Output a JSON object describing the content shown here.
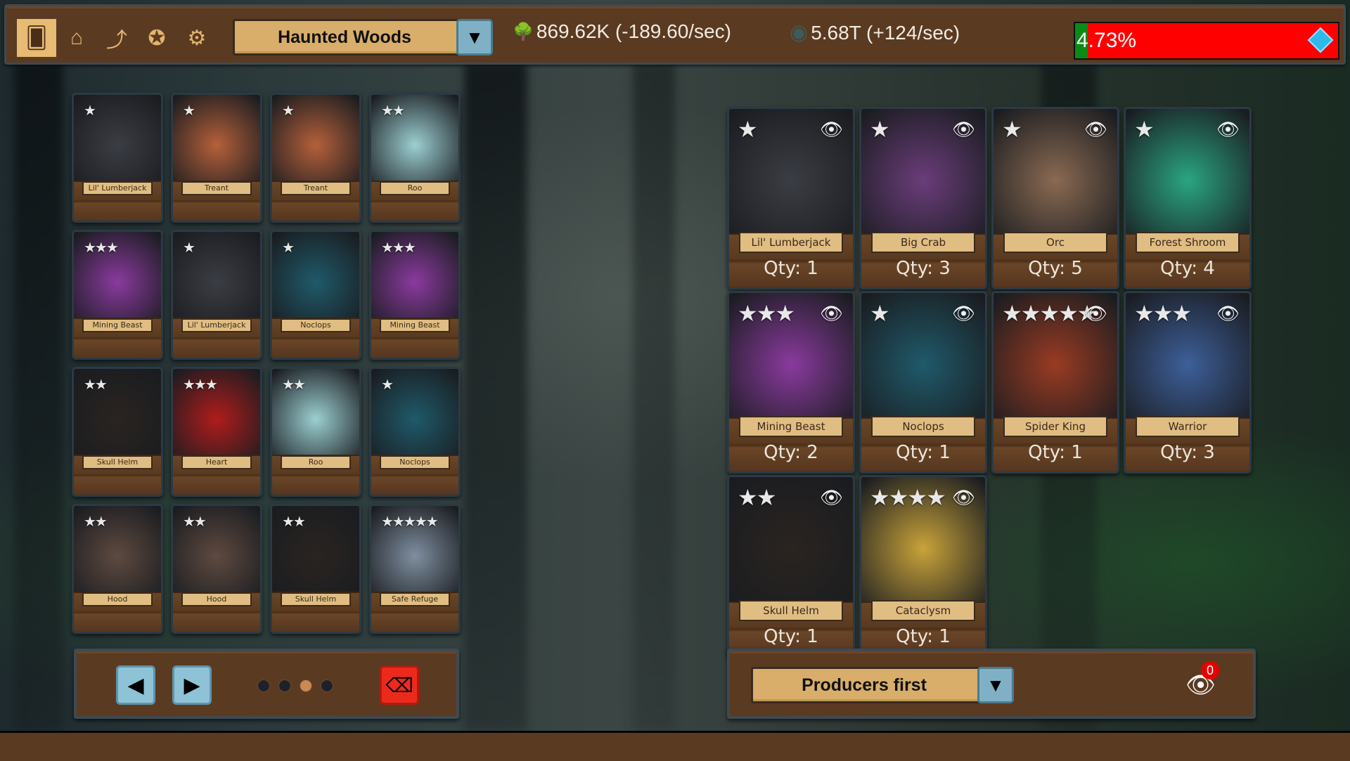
{
  "topbar": {
    "nav": [
      {
        "name": "cards-icon",
        "glyph": "🂠",
        "active": true
      },
      {
        "name": "shop-icon",
        "glyph": "⌂",
        "active": false
      },
      {
        "name": "upgrade-arrow-icon",
        "glyph": "⤴",
        "active": false
      },
      {
        "name": "achievement-medal-icon",
        "glyph": "✪",
        "active": false
      },
      {
        "name": "settings-gears-icon",
        "glyph": "⚙",
        "active": false
      }
    ],
    "region": "Haunted Woods",
    "dropdown_arrow": "▼",
    "resources": [
      {
        "icon": "tree-icon",
        "glyph": "🌳",
        "value": "869.62K (-189.60/sec)"
      },
      {
        "icon": "stone-coin-icon",
        "glyph": "◉",
        "value": "5.68T (+124/sec)"
      }
    ],
    "progress": {
      "label": "4.73%",
      "value_percent": 4.73,
      "fill_color": "#0a8a16",
      "track_color": "#ff0000"
    }
  },
  "deck": {
    "cards": [
      {
        "name": "Lil' Lumberjack",
        "stars": 1,
        "bg": "#3b3d44"
      },
      {
        "name": "Treant",
        "stars": 1,
        "bg": "#b5603a"
      },
      {
        "name": "Treant",
        "stars": 1,
        "bg": "#b5603a"
      },
      {
        "name": "Roo",
        "stars": 2,
        "bg": "#9ccfd2"
      },
      {
        "name": "Mining Beast",
        "stars": 3,
        "bg": "#8a3a9e"
      },
      {
        "name": "Lil' Lumberjack",
        "stars": 1,
        "bg": "#3b3d44"
      },
      {
        "name": "Noclops",
        "stars": 1,
        "bg": "#1f5a6a"
      },
      {
        "name": "Mining Beast",
        "stars": 3,
        "bg": "#8a3a9e"
      },
      {
        "name": "Skull Helm",
        "stars": 2,
        "bg": "#2a2420"
      },
      {
        "name": "Heart",
        "stars": 3,
        "bg": "#b01c1c"
      },
      {
        "name": "Roo",
        "stars": 2,
        "bg": "#9ccfd2"
      },
      {
        "name": "Noclops",
        "stars": 1,
        "bg": "#1f5a6a"
      },
      {
        "name": "Hood",
        "stars": 2,
        "bg": "#5e4a40"
      },
      {
        "name": "Hood",
        "stars": 2,
        "bg": "#5e4a40"
      },
      {
        "name": "Skull Helm",
        "stars": 2,
        "bg": "#2a2420"
      },
      {
        "name": "Safe Refuge",
        "stars": 5,
        "bg": "#7f8fa0"
      }
    ],
    "pager": {
      "prev": "◀",
      "next": "▶",
      "pages": 4,
      "current_page": 3,
      "clear_icon": "⌫"
    }
  },
  "collection": {
    "cards": [
      {
        "name": "Lil' Lumberjack",
        "stars": 1,
        "qty": "Qty: 1",
        "bg": "#3b3d44"
      },
      {
        "name": "Big Crab",
        "stars": 1,
        "qty": "Qty: 3",
        "bg": "#6a3d7a"
      },
      {
        "name": "Orc",
        "stars": 1,
        "qty": "Qty: 5",
        "bg": "#8a6a52"
      },
      {
        "name": "Forest Shroom",
        "stars": 1,
        "qty": "Qty: 4",
        "bg": "#2aa582"
      },
      {
        "name": "Mining Beast",
        "stars": 3,
        "qty": "Qty: 2",
        "bg": "#8a3a9e"
      },
      {
        "name": "Noclops",
        "stars": 1,
        "qty": "Qty: 1",
        "bg": "#1f5a6a"
      },
      {
        "name": "Spider King",
        "stars": 5,
        "qty": "Qty: 1",
        "bg": "#9a3b22"
      },
      {
        "name": "Warrior",
        "stars": 3,
        "qty": "Qty: 3",
        "bg": "#3d5f9a"
      },
      {
        "name": "Skull Helm",
        "stars": 2,
        "qty": "Qty: 1",
        "bg": "#2a2420"
      },
      {
        "name": "Cataclysm",
        "stars": 4,
        "qty": "Qty: 1",
        "bg": "#c9a33a"
      }
    ],
    "eye_icon": "👁",
    "sort": {
      "selected": "Producers first",
      "arrow": "▼"
    },
    "hidden_filter": {
      "icon": "👁",
      "count": "0"
    }
  }
}
